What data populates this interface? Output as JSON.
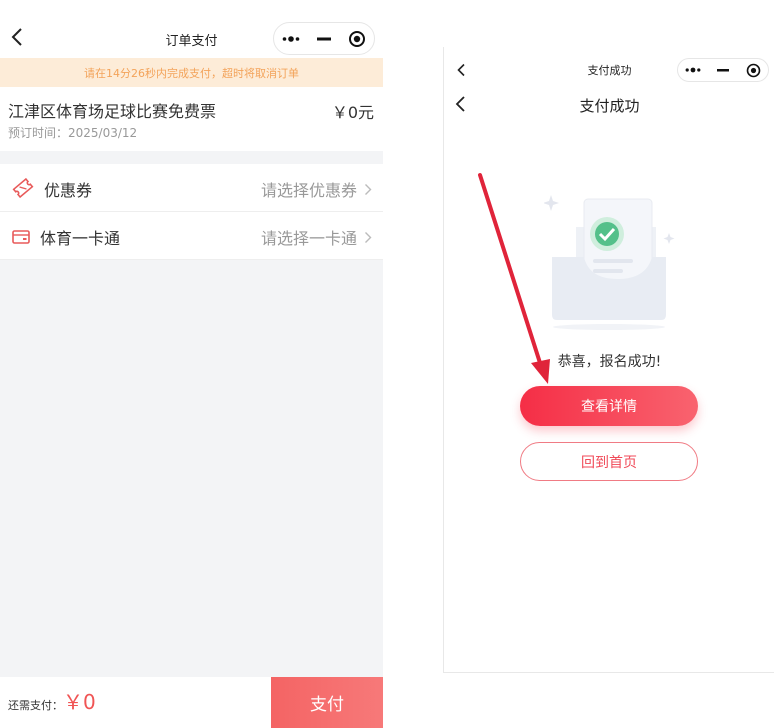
{
  "left": {
    "nav": {
      "title": "订单支付"
    },
    "banner": "请在14分26秒内完成支付，超时将取消订单",
    "order": {
      "name": "江津区体育场足球比赛免费票",
      "price": "￥0元",
      "time": "预订时间：2025/03/12"
    },
    "options": [
      {
        "label": "优惠券",
        "value": "请选择优惠券",
        "icon": "ticket-icon"
      },
      {
        "label": "体育一卡通",
        "value": "请选择一卡通",
        "icon": "card-icon"
      }
    ],
    "paybar": {
      "need_label": "还需支付：",
      "amount": "￥0",
      "pay_label": "支付"
    }
  },
  "right": {
    "nav_small_title": "支付成功",
    "page_title": "支付成功",
    "message": "恭喜，报名成功!",
    "detail_button": "查看详情",
    "home_button": "回到首页",
    "illustration": "success-document-icon"
  },
  "colors": {
    "accent": "#f52e46",
    "banner_bg": "#fdecd8",
    "banner_text": "#f3a35a",
    "annotation_arrow": "#e0243a"
  }
}
